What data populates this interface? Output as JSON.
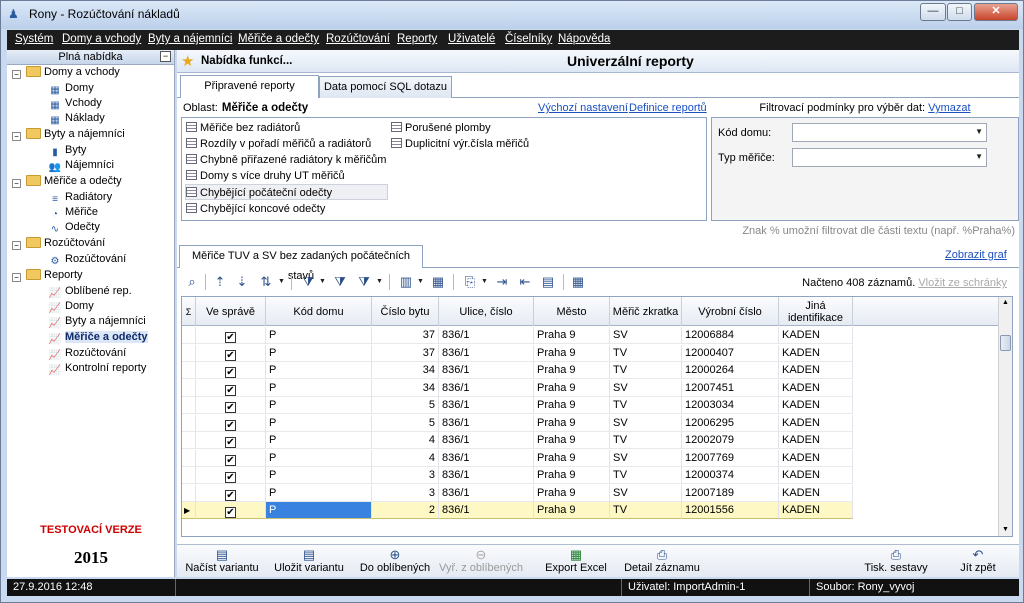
{
  "window": {
    "title": "Rony - Rozúčtování nákladů",
    "minimize": "—",
    "maximize": "□",
    "close": "✕"
  },
  "menu": [
    "Systém",
    "Domy a vchody",
    "Byty a nájemníci",
    "Měřiče a odečty",
    "Rozúčtování",
    "Reporty",
    "Uživatelé",
    "Číselníky",
    "Nápověda"
  ],
  "left": {
    "header": "Plná nabídka",
    "collapse": "−",
    "tree": [
      {
        "label": "Domy a vchody",
        "type": "folder"
      },
      {
        "label": "Domy",
        "type": "item"
      },
      {
        "label": "Vchody",
        "type": "item"
      },
      {
        "label": "Náklady",
        "type": "item"
      },
      {
        "label": "Byty a nájemníci",
        "type": "folder"
      },
      {
        "label": "Byty",
        "type": "item"
      },
      {
        "label": "Nájemníci",
        "type": "item"
      },
      {
        "label": "Měřiče a odečty",
        "type": "folder"
      },
      {
        "label": "Radiátory",
        "type": "item"
      },
      {
        "label": "Měřiče",
        "type": "item"
      },
      {
        "label": "Odečty",
        "type": "item"
      },
      {
        "label": "Rozúčtování",
        "type": "folder"
      },
      {
        "label": "Rozúčtování",
        "type": "item"
      },
      {
        "label": "Reporty",
        "type": "folder"
      },
      {
        "label": "Oblíbené rep.",
        "type": "item"
      },
      {
        "label": "Domy",
        "type": "item"
      },
      {
        "label": "Byty a nájemníci",
        "type": "item"
      },
      {
        "label": "Měřiče a odečty",
        "type": "item",
        "selected": true
      },
      {
        "label": "Rozúčtování",
        "type": "item"
      },
      {
        "label": "Kontrolní reporty",
        "type": "item"
      }
    ],
    "test_version": "TESTOVACÍ VERZE",
    "year": "2015"
  },
  "main": {
    "menu_functions": "Nabídka funkcí...",
    "title": "Univerzální reporty",
    "tabs": [
      "Připravené reporty",
      "Data pomocí SQL dotazu"
    ],
    "oblast_label": "Oblast:",
    "oblast_value": "Měřiče a odečty",
    "default_settings": "Výchozí nastavení",
    "report_definition": "Definice reportů",
    "reports_col1": [
      "Měřiče bez radiátorů",
      "Rozdíly v pořadí měřičů a radiátorů",
      "Chybně přiřazené radiátory k měřičům",
      "Domy s více druhy UT měřičů",
      "Chybějící počáteční odečty",
      "Chybějící koncové odečty"
    ],
    "reports_col2": [
      "Porušené plomby",
      "Duplicitní výr.čísla měřičů"
    ],
    "filter": {
      "header": "Filtrovací podmínky pro výběr dat:",
      "clear": "Vymazat",
      "house_code": "Kód domu:",
      "meter_type": "Typ měřiče:",
      "house_code_value": "",
      "meter_type_value": "",
      "note": "Znak % umožní filtrovat dle části textu (např. %Praha%)"
    },
    "result_tab": "Měřiče TUV a SV bez zadaných počátečních stavů",
    "show_chart": "Zobrazit graf",
    "loaded": "Načteno 408 záznamů.",
    "paste_clipboard": "Vložit ze schránky",
    "table": {
      "sigma": "Σ",
      "columns": [
        "Ve správě",
        "Kód domu",
        "Číslo bytu",
        "Ulice, číslo",
        "Město",
        "Měřič zkratka",
        "Výrobní číslo",
        "Jiná identifikace"
      ],
      "rows": [
        [
          "✔",
          "P",
          "37",
          "836/1",
          "Praha 9",
          "SV",
          "12006884",
          "KADEN"
        ],
        [
          "✔",
          "P",
          "37",
          "836/1",
          "Praha 9",
          "TV",
          "12000407",
          "KADEN"
        ],
        [
          "✔",
          "P",
          "34",
          "836/1",
          "Praha 9",
          "TV",
          "12000264",
          "KADEN"
        ],
        [
          "✔",
          "P",
          "34",
          "836/1",
          "Praha 9",
          "SV",
          "12007451",
          "KADEN"
        ],
        [
          "✔",
          "P",
          "5",
          "836/1",
          "Praha 9",
          "TV",
          "12003034",
          "KADEN"
        ],
        [
          "✔",
          "P",
          "5",
          "836/1",
          "Praha 9",
          "SV",
          "12006295",
          "KADEN"
        ],
        [
          "✔",
          "P",
          "4",
          "836/1",
          "Praha 9",
          "TV",
          "12002079",
          "KADEN"
        ],
        [
          "✔",
          "P",
          "4",
          "836/1",
          "Praha 9",
          "SV",
          "12007769",
          "KADEN"
        ],
        [
          "✔",
          "P",
          "3",
          "836/1",
          "Praha 9",
          "TV",
          "12000374",
          "KADEN"
        ],
        [
          "✔",
          "P",
          "3",
          "836/1",
          "Praha 9",
          "SV",
          "12007189",
          "KADEN"
        ],
        [
          "✔",
          "P",
          "2",
          "836/1",
          "Praha 9",
          "TV",
          "12001556",
          "KADEN"
        ]
      ]
    },
    "bottom_buttons": [
      "Načíst variantu",
      "Uložit variantu",
      "Do oblíbených",
      "Vyř. z oblíbených",
      "Export Excel",
      "Detail záznamu",
      "Tisk. sestavy",
      "Jít zpět"
    ]
  },
  "status": {
    "datetime": "27.9.2016  12:48",
    "user": "Uživatel: ImportAdmin-1",
    "file": "Soubor: Rony_vyvoj"
  }
}
